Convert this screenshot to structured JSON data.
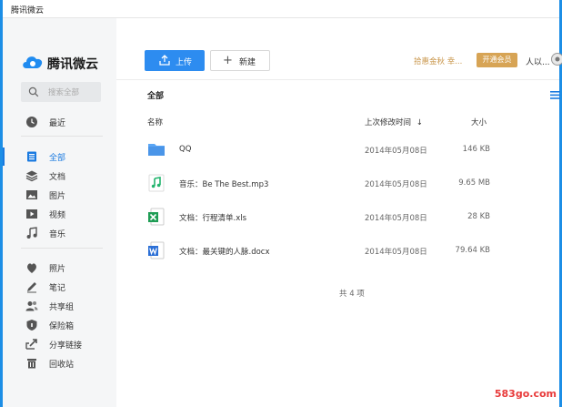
{
  "window": {
    "title": "腾讯微云"
  },
  "logo": {
    "text": "腾讯微云"
  },
  "search": {
    "placeholder": "搜索全部"
  },
  "sidebar": {
    "items": [
      {
        "label": "最近",
        "icon": "clock-icon"
      },
      {
        "label": "全部",
        "icon": "doc-all-icon",
        "active": true
      },
      {
        "label": "文档",
        "icon": "layers-icon"
      },
      {
        "label": "图片",
        "icon": "image-icon"
      },
      {
        "label": "视频",
        "icon": "video-icon"
      },
      {
        "label": "音乐",
        "icon": "music-icon"
      },
      {
        "label": "照片",
        "icon": "photo-icon"
      },
      {
        "label": "笔记",
        "icon": "pen-icon"
      },
      {
        "label": "共享组",
        "icon": "group-icon"
      },
      {
        "label": "保险箱",
        "icon": "shield-icon"
      },
      {
        "label": "分享链接",
        "icon": "share-icon"
      },
      {
        "label": "回收站",
        "icon": "trash-icon"
      }
    ]
  },
  "toolbar": {
    "upload_label": "上传",
    "new_label": "新建",
    "promo_text": "拾惠金秋 幸...",
    "vip_label": "开通会员",
    "user_name": "人以..."
  },
  "files": {
    "section_title": "全部",
    "columns": {
      "name": "名称",
      "time": "上次修改时间",
      "size": "大小"
    },
    "rows": [
      {
        "name": "QQ",
        "time": "2014年05月08日",
        "size": "146 KB",
        "icon": "folder-icon"
      },
      {
        "name": "音乐：Be The Best.mp3",
        "time": "2014年05月08日",
        "size": "9.65 MB",
        "icon": "music-file-icon"
      },
      {
        "name": "文档：行程清单.xls",
        "time": "2014年05月08日",
        "size": "28 KB",
        "icon": "excel-file-icon"
      },
      {
        "name": "文档：最关键的人脉.docx",
        "time": "2014年05月08日",
        "size": "79.64 KB",
        "icon": "word-file-icon"
      }
    ],
    "total": "共 4 项"
  },
  "watermark": "583go.com",
  "colors": {
    "accent": "#2d8cf0",
    "vip": "#d7a455",
    "promo": "#c9964b",
    "frame": "#1c8ee6"
  }
}
